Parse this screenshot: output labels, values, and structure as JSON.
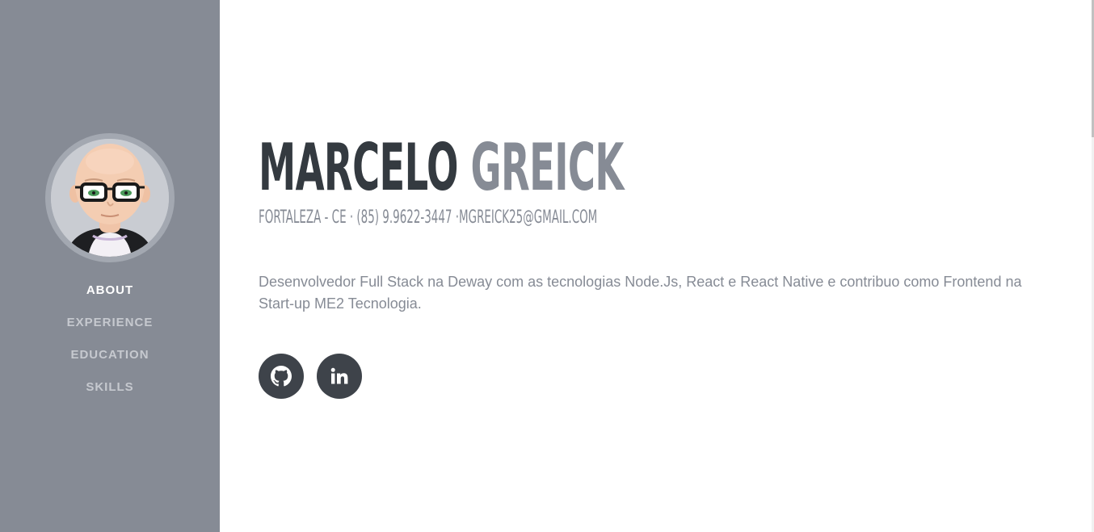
{
  "sidebar": {
    "avatar_alt": "avatar",
    "nav": [
      {
        "label": "ABOUT",
        "active": true
      },
      {
        "label": "EXPERIENCE",
        "active": false
      },
      {
        "label": "EDUCATION",
        "active": false
      },
      {
        "label": "SKILLS",
        "active": false
      }
    ]
  },
  "profile": {
    "first_name": "MARCELO",
    "last_name": "GREICK",
    "contact": "FORTALEZA - CE · (85) 9.9622-3447 ·MGREICK25@GMAIL.COM",
    "bio": "Desenvolvedor Full Stack na Deway com as tecnologias Node.Js, React e React Native e contribuo como Frontend na Start-up ME2 Tecnologia."
  },
  "social": [
    {
      "icon": "github-icon"
    },
    {
      "icon": "linkedin-icon"
    }
  ],
  "colors": {
    "sidebar_bg": "#868b95",
    "primary_dark": "#343a40",
    "accent_gray": "#868b95",
    "button_bg": "#3e434a"
  }
}
